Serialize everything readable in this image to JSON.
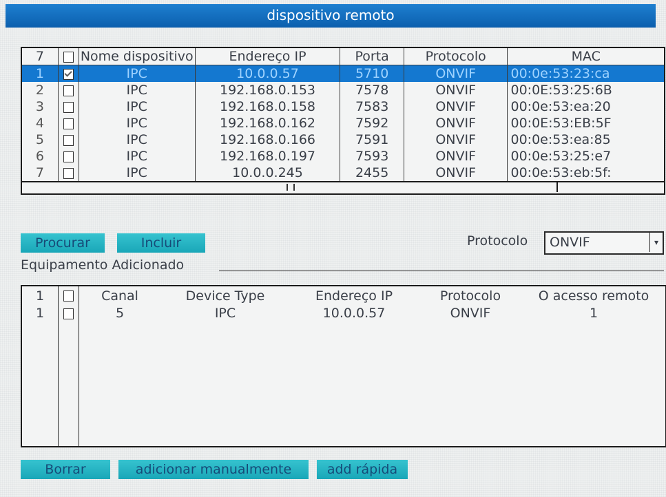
{
  "title": "dispositivo remoto",
  "search_table": {
    "count": "7",
    "headers": [
      "",
      "Nome dispositivo",
      "Endereço IP",
      "Porta",
      "Protocolo",
      "MAC"
    ],
    "rows": [
      {
        "idx": "1",
        "checked": true,
        "name": "IPC",
        "ip": "10.0.0.57",
        "port": "5710",
        "protocol": "ONVIF",
        "mac": "00:0e:53:23:ca",
        "selected": true
      },
      {
        "idx": "2",
        "checked": false,
        "name": "IPC",
        "ip": "192.168.0.153",
        "port": "7578",
        "protocol": "ONVIF",
        "mac": "00:0E:53:25:6B"
      },
      {
        "idx": "3",
        "checked": false,
        "name": "IPC",
        "ip": "192.168.0.158",
        "port": "7583",
        "protocol": "ONVIF",
        "mac": "00:0e:53:ea:20"
      },
      {
        "idx": "4",
        "checked": false,
        "name": "IPC",
        "ip": "192.168.0.162",
        "port": "7592",
        "protocol": "ONVIF",
        "mac": "00:0E:53:EB:5F"
      },
      {
        "idx": "5",
        "checked": false,
        "name": "IPC",
        "ip": "192.168.0.166",
        "port": "7591",
        "protocol": "ONVIF",
        "mac": "00:0e:53:ea:85"
      },
      {
        "idx": "6",
        "checked": false,
        "name": "IPC",
        "ip": "192.168.0.197",
        "port": "7593",
        "protocol": "ONVIF",
        "mac": "00:0e:53:25:e7"
      },
      {
        "idx": "7",
        "checked": false,
        "name": "IPC",
        "ip": "10.0.0.245",
        "port": "2455",
        "protocol": "ONVIF",
        "mac": "00:0e:53:eb:5f:"
      }
    ]
  },
  "buttons": {
    "search": "Procurar",
    "add": "Incluir",
    "delete": "Borrar",
    "add_manual": "adicionar manualmente",
    "quick_add": "add rápida"
  },
  "protocol_filter": {
    "label": "Protocolo",
    "value": "ONVIF"
  },
  "added_section": {
    "label": "Equipamento Adicionado"
  },
  "added_table": {
    "count": "1",
    "headers": [
      "",
      "Canal",
      "Device Type",
      "Endereço IP",
      "Protocolo",
      "O acesso remoto"
    ],
    "rows": [
      {
        "idx": "1",
        "checked": false,
        "channel": "5",
        "type": "IPC",
        "ip": "10.0.0.57",
        "protocol": "ONVIF",
        "remote": "1"
      }
    ]
  },
  "colors": {
    "title_bar": "#0b5fae",
    "selected_row": "#1478d0",
    "button": "#19a7b8"
  }
}
